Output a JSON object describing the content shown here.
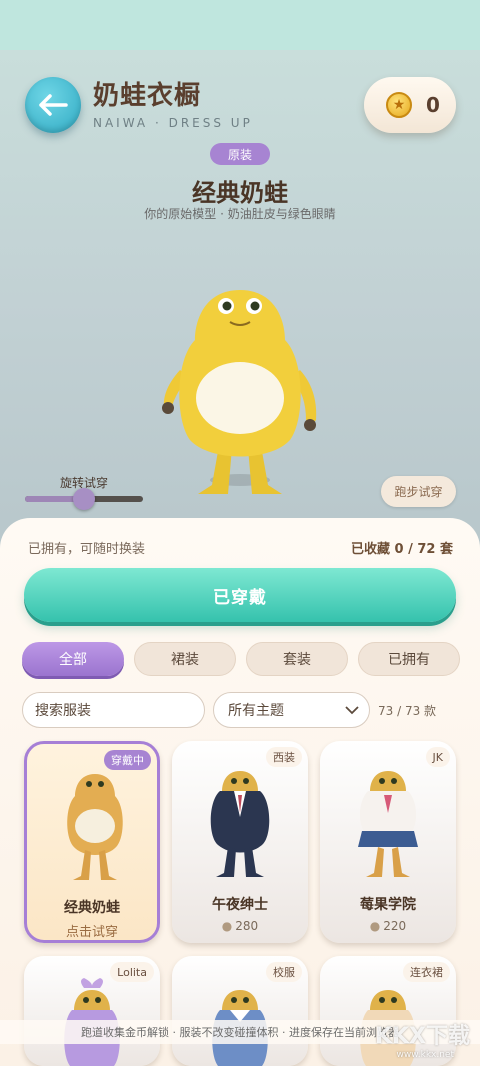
{
  "header": {
    "title": "奶蛙衣橱",
    "subtitle": "NAIWA · DRESS UP",
    "coins": "0"
  },
  "current_outfit": {
    "tag": "原装",
    "name": "经典奶蛙",
    "description": "你的原始模型 · 奶油肚皮与绿色眼睛"
  },
  "controls": {
    "rotate_label": "旋转试穿",
    "rotate_value": 0.5,
    "run_label": "跑步试穿"
  },
  "panel": {
    "owned_hint": "已拥有，可随时换装",
    "collected": "已收藏 0 / 72 套",
    "wear_button": "已穿戴",
    "tabs": [
      "全部",
      "裙装",
      "套装",
      "已拥有"
    ],
    "search_placeholder": "搜索服装",
    "theme_selected": "所有主题",
    "count": "73 / 73 款"
  },
  "cards": [
    {
      "badge": "穿戴中",
      "name": "经典奶蛙",
      "action": "点击试穿"
    },
    {
      "badge": "西装",
      "name": "午夜绅士",
      "price": "280"
    },
    {
      "badge": "JK",
      "name": "莓果学院",
      "price": "220"
    },
    {
      "badge": "Lolita"
    },
    {
      "badge": "校服"
    },
    {
      "badge": "连衣裙"
    }
  ],
  "footer": {
    "note": "跑道收集金币解锁 · 服装不改变碰撞体积 · 进度保存在当前浏览器"
  },
  "watermark": {
    "text": "KKX下载",
    "url": "www.kkx.net"
  },
  "colors": {
    "accent_purple": "#a784d2",
    "accent_teal": "#35c2ad",
    "frog_yellow": "#f2cf3c"
  }
}
